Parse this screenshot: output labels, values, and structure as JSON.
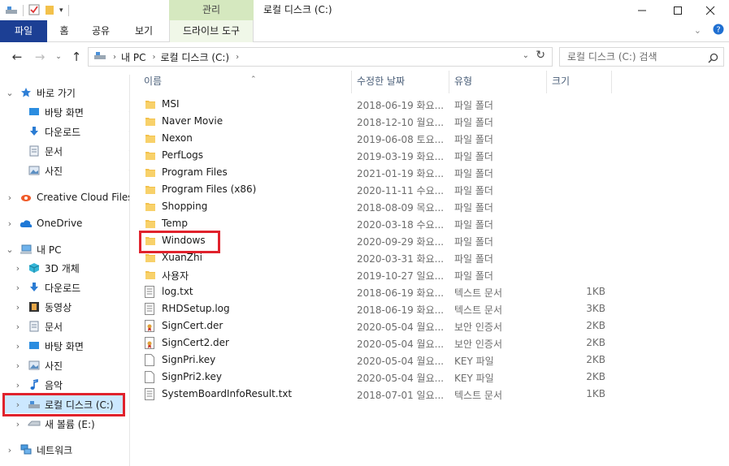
{
  "window": {
    "title": "로컬 디스크 (C:)",
    "context_tab_group": "관리"
  },
  "ribbon": {
    "tabs": [
      "파일",
      "홈",
      "공유",
      "보기"
    ],
    "context_tab": "드라이브 도구"
  },
  "address": {
    "crumbs": [
      "내 PC",
      "로컬 디스크 (C:)"
    ],
    "search_placeholder": "로컬 디스크 (C:) 검색"
  },
  "nav": {
    "quick_access": "바로 가기",
    "quick_items": [
      "바탕 화면",
      "다운로드",
      "문서",
      "사진"
    ],
    "creative_cloud": "Creative Cloud Files",
    "onedrive": "OneDrive",
    "this_pc": "내 PC",
    "pc_items": [
      "3D 개체",
      "다운로드",
      "동영상",
      "문서",
      "바탕 화면",
      "사진",
      "음악",
      "로컬 디스크 (C:)",
      "새 볼륨 (E:)"
    ],
    "network": "네트워크"
  },
  "columns": {
    "name": "이름",
    "date": "수정한 날짜",
    "type": "유형",
    "size": "크기"
  },
  "files": [
    {
      "name": "MSI",
      "date": "2018-06-19 화요...",
      "type": "파일 폴더",
      "size": "",
      "kind": "folder"
    },
    {
      "name": "Naver Movie",
      "date": "2018-12-10 월요...",
      "type": "파일 폴더",
      "size": "",
      "kind": "folder"
    },
    {
      "name": "Nexon",
      "date": "2019-06-08 토요...",
      "type": "파일 폴더",
      "size": "",
      "kind": "folder"
    },
    {
      "name": "PerfLogs",
      "date": "2019-03-19 화요...",
      "type": "파일 폴더",
      "size": "",
      "kind": "folder"
    },
    {
      "name": "Program Files",
      "date": "2021-01-19 화요...",
      "type": "파일 폴더",
      "size": "",
      "kind": "folder"
    },
    {
      "name": "Program Files (x86)",
      "date": "2020-11-11 수요...",
      "type": "파일 폴더",
      "size": "",
      "kind": "folder"
    },
    {
      "name": "Shopping",
      "date": "2018-08-09 목요...",
      "type": "파일 폴더",
      "size": "",
      "kind": "folder"
    },
    {
      "name": "Temp",
      "date": "2020-03-18 수요...",
      "type": "파일 폴더",
      "size": "",
      "kind": "folder"
    },
    {
      "name": "Windows",
      "date": "2020-09-29 화요...",
      "type": "파일 폴더",
      "size": "",
      "kind": "folder"
    },
    {
      "name": "XuanZhi",
      "date": "2020-03-31 화요...",
      "type": "파일 폴더",
      "size": "",
      "kind": "folder"
    },
    {
      "name": "사용자",
      "date": "2019-10-27 일요...",
      "type": "파일 폴더",
      "size": "",
      "kind": "folder"
    },
    {
      "name": "log.txt",
      "date": "2018-06-19 화요...",
      "type": "텍스트 문서",
      "size": "1KB",
      "kind": "text"
    },
    {
      "name": "RHDSetup.log",
      "date": "2018-06-19 화요...",
      "type": "텍스트 문서",
      "size": "3KB",
      "kind": "text"
    },
    {
      "name": "SignCert.der",
      "date": "2020-05-04 월요...",
      "type": "보안 인증서",
      "size": "2KB",
      "kind": "cert"
    },
    {
      "name": "SignCert2.der",
      "date": "2020-05-04 월요...",
      "type": "보안 인증서",
      "size": "2KB",
      "kind": "cert"
    },
    {
      "name": "SignPri.key",
      "date": "2020-05-04 월요...",
      "type": "KEY 파일",
      "size": "2KB",
      "kind": "blank"
    },
    {
      "name": "SignPri2.key",
      "date": "2020-05-04 월요...",
      "type": "KEY 파일",
      "size": "2KB",
      "kind": "blank"
    },
    {
      "name": "SystemBoardInfoResult.txt",
      "date": "2018-07-01 일요...",
      "type": "텍스트 문서",
      "size": "1KB",
      "kind": "text"
    }
  ],
  "colors": {
    "file_tab": "#1c3f94",
    "context_tab": "#d5e8bf",
    "selection": "#cce8ff",
    "highlight_box": "#e0222c",
    "folder": "#f3c14b"
  }
}
